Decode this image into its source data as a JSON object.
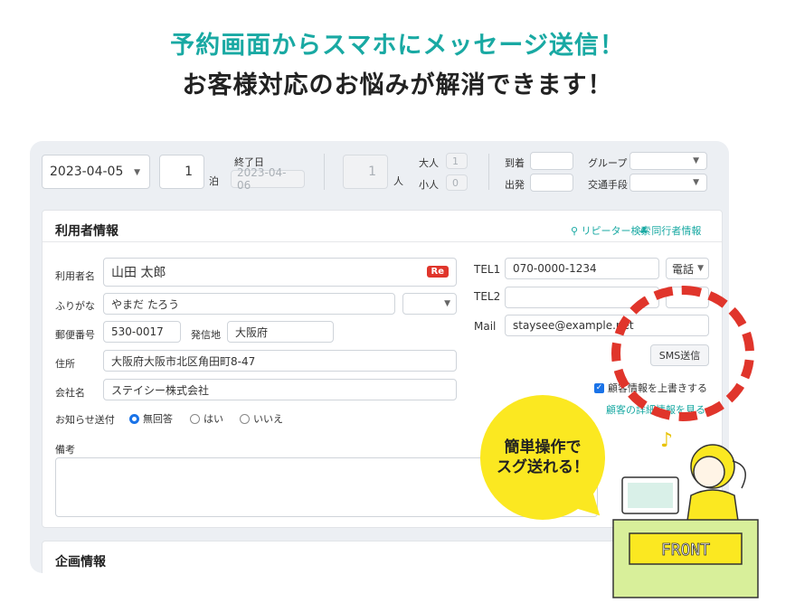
{
  "headline": {
    "line1": "予約画面からスマホにメッセージ送信！",
    "line2": "お客様対応のお悩みが解消できます！"
  },
  "topbar": {
    "start_date": "2023-04-05",
    "nights": "1",
    "nights_unit": "泊",
    "end_label": "終了日",
    "end_date": "2023-04-06",
    "people": "1",
    "people_unit": "人",
    "adult_label": "大人",
    "adult_value": "1",
    "child_label": "小人",
    "child_value": "0",
    "arrival_label": "到着",
    "departure_label": "出発",
    "group_label": "グループ",
    "transport_label": "交通手段"
  },
  "guest": {
    "section_title": "利用者情報",
    "repeater_search": "リピーター検索",
    "companion_info": "同行者情報",
    "name_label": "利用者名",
    "name_value": "山田 太郎",
    "re_badge": "Re",
    "kana_label": "ふりがな",
    "kana_value": "やまだ たろう",
    "zip_label": "郵便番号",
    "zip_value": "530-0017",
    "origin_label": "発信地",
    "origin_value": "大阪府",
    "address_label": "住所",
    "address_value": "大阪府大阪市北区角田町8-47",
    "company_label": "会社名",
    "company_value": "ステイシー株式会社",
    "notify_label": "お知らせ送付",
    "notify_options": [
      "無回答",
      "はい",
      "いいえ"
    ],
    "notes_label": "備考",
    "tel1_label": "TEL1",
    "tel1_value": "070-0000-1234",
    "tel1_type": "電話",
    "tel2_label": "TEL2",
    "mail_label": "Mail",
    "mail_value": "staysee@example.net",
    "sms_button": "SMS送信",
    "overwrite_label": "顧客情報を上書きする",
    "detail_link": "顧客の詳細情報を見る"
  },
  "plan": {
    "section_title": "企画情報"
  },
  "callout": {
    "line1": "簡単操作で",
    "line2": "スグ送れる！",
    "sign": "FRONT"
  },
  "colors": {
    "accent": "#19a9a3",
    "dots": "#e0352b",
    "bubble": "#fbe821",
    "badge": "#e0352b",
    "checkbox": "#1a73e8"
  }
}
